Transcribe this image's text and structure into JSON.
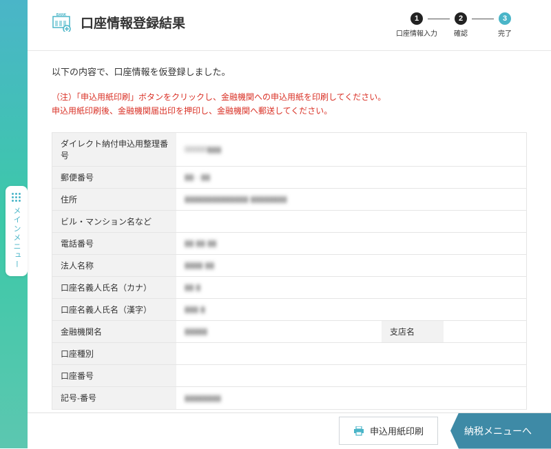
{
  "header": {
    "title": "口座情報登録結果",
    "steps": [
      {
        "num": "1",
        "label": "口座情報入力",
        "active": false
      },
      {
        "num": "2",
        "label": "確認",
        "active": false
      },
      {
        "num": "3",
        "label": "完了",
        "active": true
      }
    ]
  },
  "sidebar": {
    "main_menu_label": "メインメニュー"
  },
  "content": {
    "intro": "以下の内容で、口座情報を仮登録しました。",
    "warning_line1": "（注）「申込用紙印刷」ボタンをクリックし、金融機関への申込用紙を印刷してください。",
    "warning_line2": "申込用紙印刷後、金融機関届出印を押印し、金融機関へ郵送してください。"
  },
  "fields": {
    "reference_number": {
      "label": "ダイレクト納付申込用整理番号",
      "value": "00000▮▮▮"
    },
    "postal_code": {
      "label": "郵便番号",
      "value": "▮▮ - ▮▮"
    },
    "address": {
      "label": "住所",
      "value": "▮▮▮▮▮▮▮▮▮▮▮▮▮▮ ▮▮▮▮▮▮▮▮"
    },
    "building": {
      "label": "ビル・マンション名など",
      "value": ""
    },
    "phone": {
      "label": "電話番号",
      "value": "▮▮ ▮▮ ▮▮"
    },
    "corp_name": {
      "label": "法人名称",
      "value": "▮▮▮▮ ▮▮"
    },
    "account_kana": {
      "label": "口座名義人氏名（カナ）",
      "value": "▮▮ ▮"
    },
    "account_kanji": {
      "label": "口座名義人氏名（漢字）",
      "value": "▮▮▮ ▮"
    },
    "bank_name": {
      "label": "金融機関名",
      "value": "▮▮▮▮▮"
    },
    "branch_name": {
      "label": "支店名",
      "value": ""
    },
    "account_type": {
      "label": "口座種別",
      "value": ""
    },
    "account_number": {
      "label": "口座番号",
      "value": ""
    },
    "symbol_number": {
      "label": "記号-番号",
      "value": "▮▮▮▮▮▮▮▮"
    }
  },
  "buttons": {
    "print": "申込用紙印刷",
    "next": "納税メニューへ"
  }
}
